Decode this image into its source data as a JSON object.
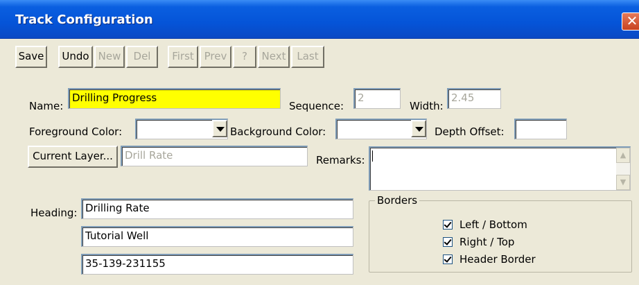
{
  "window": {
    "title": "Track Configuration",
    "close_glyph": "✕"
  },
  "toolbar": {
    "save": "Save",
    "undo": "Undo",
    "new": "New",
    "del": "Del",
    "first": "First",
    "prev": "Prev",
    "help": "?",
    "next": "Next",
    "last": "Last"
  },
  "form": {
    "name_label": "Name:",
    "name_value": "Drilling Progress",
    "sequence_label": "Sequence:",
    "sequence_value": "2",
    "width_label": "Width:",
    "width_value": "2.45",
    "foreground_label": "Foreground Color:",
    "foreground_value": "",
    "background_label": "Background Color:",
    "background_value": "",
    "depth_offset_label": "Depth Offset:",
    "depth_offset_value": "",
    "current_layer_button": "Current Layer...",
    "current_layer_value": "Drill Rate",
    "remarks_label": "Remarks:",
    "remarks_value": "",
    "heading_label": "Heading:",
    "heading_lines": [
      "Drilling Rate",
      "Tutorial Well",
      "35-139-231155"
    ]
  },
  "borders": {
    "legend": "Borders",
    "options": [
      {
        "label": "Left / Bottom",
        "checked": true
      },
      {
        "label": "Right / Top",
        "checked": true
      },
      {
        "label": "Header Border",
        "checked": true
      }
    ]
  },
  "icons": {
    "close": "close-icon",
    "dropdown": "chevron-down-icon",
    "scroll_up": "arrow-up-icon",
    "scroll_down": "arrow-down-icon",
    "check": "check-icon"
  },
  "colors": {
    "name_highlight": "#ffff00",
    "titlebar": "#0554d8",
    "close_button": "#c8421f"
  }
}
